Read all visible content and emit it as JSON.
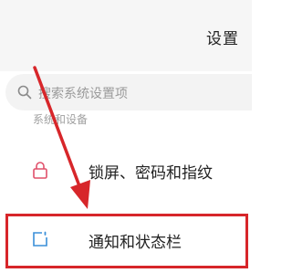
{
  "header": {
    "title": "设置"
  },
  "search": {
    "placeholder": "搜索系统设置项",
    "icon": "search-icon"
  },
  "section": {
    "label": "系统和设备"
  },
  "settings": {
    "items": [
      {
        "label": "锁屏、密码和指纹",
        "icon": "lock-icon",
        "icon_color": "#e0506a"
      },
      {
        "label": "通知和状态栏",
        "icon": "notification-icon",
        "icon_color": "#3a8fd8"
      }
    ]
  },
  "annotation": {
    "color": "#d7262a",
    "highlighted_item": "通知和状态栏"
  }
}
